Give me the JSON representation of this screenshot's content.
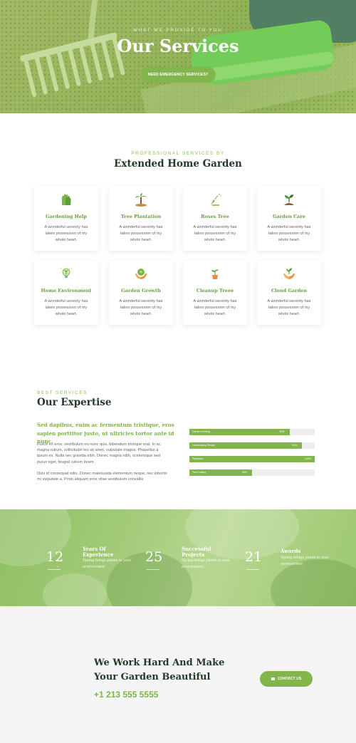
{
  "hero": {
    "subtitle": "WHAT WE PROVIDE TO YOU",
    "title": "Our Services",
    "button": "NEED EMERGENCY SERVICES?"
  },
  "services": {
    "eyebrow": "PROFESSIONAL SERVICES BY",
    "title": "Extended Home Garden",
    "items": [
      {
        "title": "Gardening Help",
        "desc": "A wonderful serenity has taken possession of my whole heart.",
        "icon": "gardening-gloves-icon"
      },
      {
        "title": "Tree Plantation",
        "desc": "A wonderful serenity has taken possession of my whole heart.",
        "icon": "palm-tree-icon"
      },
      {
        "title": "Roses Tree",
        "desc": "A wonderful serenity has taken possession of my whole heart.",
        "icon": "watering-sprout-icon"
      },
      {
        "title": "Garden Care",
        "desc": "A wonderful serenity has taken possession of my whole heart.",
        "icon": "seedling-soil-icon"
      },
      {
        "title": "Home Environment",
        "desc": "A wonderful serenity has taken possession of my whole heart.",
        "icon": "eco-bulb-icon"
      },
      {
        "title": "Garden Growth",
        "desc": "A wonderful serenity has taken possession of my whole heart.",
        "icon": "hands-globe-icon"
      },
      {
        "title": "Cleanup Treee",
        "desc": "A wonderful serenity has taken possession of my whole heart.",
        "icon": "potted-plant-icon"
      },
      {
        "title": "Cloud Garden",
        "desc": "A wonderful serenity has taken possession of my whole heart.",
        "icon": "hands-sprout-icon"
      }
    ]
  },
  "expertise": {
    "eyebrow": "BEST SERVICES",
    "title": "Our Expertise",
    "lead": "Sed dapibus, enim ac fermentum tristique, eros sapien porttitor justo, ut ultricies tortor ante id nunc.",
    "para1": "Fusce ex eros, vestibulum eu nunc quis, bibendum tristique erat. In ac magna rutrum, sollicitudin leo sit amet, vulputate magna. Phasellus a ipsum ex. Nulla nec gravida nibh. Donec magna nibh, scelerisque sed purus eget, feugiat rutrum lorem.",
    "para2": "Duis id consequat odio. Donec malesuada elementum neque, nec lobortis mi vulputate a. Proin aliquam eros vitae vestibulum convallis",
    "skills": [
      {
        "label": "Garden Mowing",
        "percent": 80,
        "percent_text": "80%"
      },
      {
        "label": "Landscaping Design",
        "percent": 90,
        "percent_text": "90%"
      },
      {
        "label": "Plantation",
        "percent": 100,
        "percent_text": "100%"
      },
      {
        "label": "Tree Cutting",
        "percent": 50,
        "percent_text": "50%"
      }
    ]
  },
  "stats": [
    {
      "number": "12",
      "suffix": "+",
      "title": "Years Of Experience",
      "desc": "Spring brings plants to your environment"
    },
    {
      "number": "25",
      "suffix": "",
      "title": "Successful Projects",
      "desc": "Spring brings plants to your environment"
    },
    {
      "number": "21",
      "suffix": "",
      "title": "Awards",
      "desc": "Spring brings plants to your environment"
    }
  ],
  "cta": {
    "title": "We Work Hard And Make Your Garden Beautiful",
    "phone": "+1 213 555 5555",
    "button": "CONTACT US"
  },
  "colors": {
    "accent": "#82b54b",
    "heading": "#233a2a",
    "light_bg": "#f5f5f5"
  }
}
